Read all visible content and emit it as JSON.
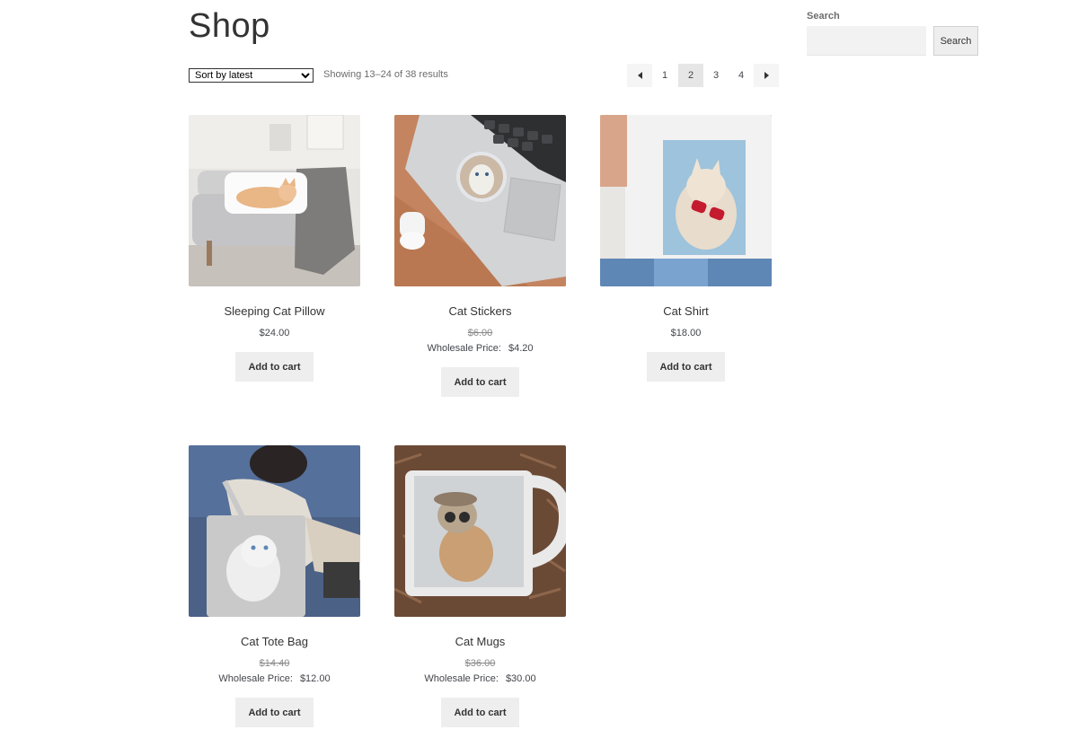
{
  "page": {
    "title": "Shop"
  },
  "toolbar": {
    "sort_value": "Sort by latest",
    "sort_options": [
      "Sort by latest"
    ],
    "result_count": "Showing 13–24 of 38 results"
  },
  "pagination": {
    "pages": [
      "1",
      "2",
      "3",
      "4"
    ],
    "current": "2"
  },
  "search": {
    "label": "Search",
    "button": "Search",
    "value": "",
    "placeholder": ""
  },
  "products": [
    {
      "name": "Sleeping Cat Pillow",
      "price": "$24.00",
      "button": "Add to cart"
    },
    {
      "name": "Cat Stickers",
      "old_price": "$6.00",
      "wholesale_label": "Wholesale Price:",
      "wholesale_price": "$4.20",
      "button": "Add to cart"
    },
    {
      "name": "Cat Shirt",
      "price": "$18.00",
      "button": "Add to cart"
    },
    {
      "name": "Cat Tote Bag",
      "old_price": "$14.40",
      "wholesale_label": "Wholesale Price:",
      "wholesale_price": "$12.00",
      "button": "Add to cart"
    },
    {
      "name": "Cat Mugs",
      "old_price": "$36.00",
      "wholesale_label": "Wholesale Price:",
      "wholesale_price": "$30.00",
      "button": "Add to cart"
    }
  ]
}
